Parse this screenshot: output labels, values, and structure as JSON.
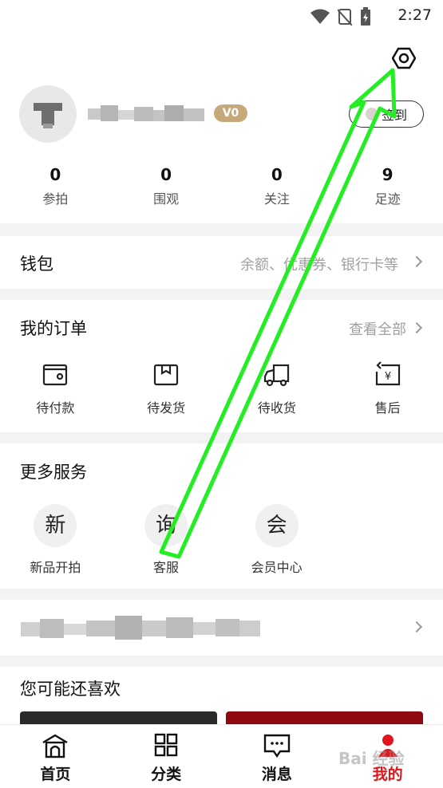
{
  "status_bar": {
    "time": "2:27",
    "icons": [
      "wifi-icon",
      "no-sim-icon",
      "battery-charging-icon"
    ]
  },
  "profile": {
    "settings_icon": "gear-icon",
    "vip_badge": "V0",
    "sign_in_label": "签到",
    "stats": [
      {
        "value": "0",
        "label": "参拍"
      },
      {
        "value": "0",
        "label": "围观"
      },
      {
        "value": "0",
        "label": "关注"
      },
      {
        "value": "9",
        "label": "足迹"
      }
    ]
  },
  "wallet": {
    "title": "钱包",
    "desc": "余额、优惠券、银行卡等"
  },
  "orders": {
    "title": "我的订单",
    "view_all": "查看全部",
    "items": [
      {
        "label": "待付款",
        "icon": "wallet-icon"
      },
      {
        "label": "待发货",
        "icon": "box-icon"
      },
      {
        "label": "待收货",
        "icon": "truck-icon"
      },
      {
        "label": "售后",
        "icon": "refund-icon"
      }
    ]
  },
  "services": {
    "title": "更多服务",
    "items": [
      {
        "glyph": "新",
        "label": "新品开拍"
      },
      {
        "glyph": "询",
        "label": "客服"
      },
      {
        "glyph": "会",
        "label": "会员中心"
      }
    ]
  },
  "recommend": {
    "title": "您可能还喜欢"
  },
  "tabs": [
    {
      "label": "首页",
      "icon": "home-icon"
    },
    {
      "label": "分类",
      "icon": "grid-icon"
    },
    {
      "label": "消息",
      "icon": "message-icon"
    },
    {
      "label": "我的",
      "icon": "profile-icon"
    }
  ],
  "watermark": "Bai 经验",
  "colors": {
    "accent": "#e1161d",
    "vip": "#c7a87a",
    "annotation": "#22ee22"
  }
}
